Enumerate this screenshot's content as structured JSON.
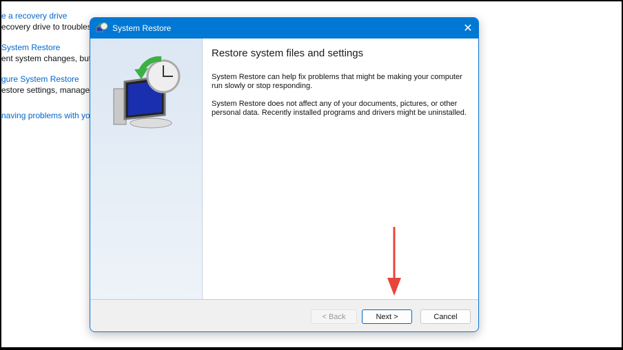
{
  "background": {
    "links": [
      {
        "link": "e a recovery drive",
        "desc": "ecovery drive to troubleshoot"
      },
      {
        "link": "System Restore",
        "desc": "ent system changes, but"
      },
      {
        "link": "gure System Restore",
        "desc": "estore settings, manage"
      },
      {
        "link": "naving problems with your",
        "desc": ""
      }
    ]
  },
  "dialog": {
    "title": "System Restore",
    "heading": "Restore system files and settings",
    "para1": "System Restore can help fix problems that might be making your computer run slowly or stop responding.",
    "para2": "System Restore does not affect any of your documents, pictures, or other personal data. Recently installed programs and drivers might be uninstalled.",
    "back_label": "< Back",
    "next_label": "Next >",
    "cancel_label": "Cancel",
    "close_glyph": "✕"
  },
  "colors": {
    "accent": "#0078d4",
    "annotation": "#e8443a"
  }
}
